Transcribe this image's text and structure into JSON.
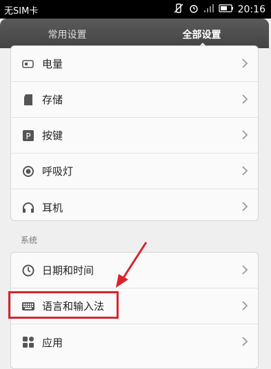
{
  "status": {
    "carrier": "无SIM卡",
    "time": "20:16"
  },
  "tabs": [
    {
      "label": "常用设置"
    },
    {
      "label": "全部设置"
    }
  ],
  "group1": {
    "items": [
      {
        "label": "电量",
        "icon": "battery-icon"
      },
      {
        "label": "存储",
        "icon": "sd-card-icon"
      },
      {
        "label": "按键",
        "icon": "key-icon"
      },
      {
        "label": "呼吸灯",
        "icon": "light-icon"
      },
      {
        "label": "耳机",
        "icon": "headphones-icon"
      }
    ]
  },
  "section_system": "系统",
  "group2": {
    "items": [
      {
        "label": "日期和时间",
        "icon": "clock-icon"
      },
      {
        "label": "语言和输入法",
        "icon": "keyboard-icon"
      },
      {
        "label": "应用",
        "icon": "apps-icon"
      }
    ]
  },
  "annotation_color": "#d9232c"
}
